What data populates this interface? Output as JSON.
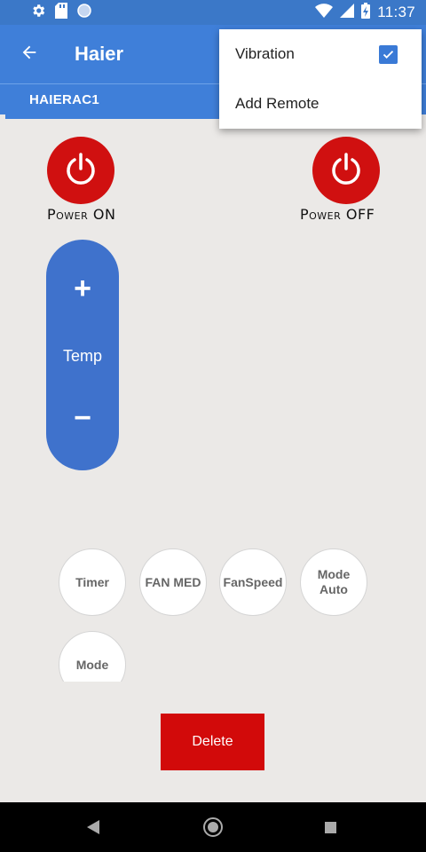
{
  "status_bar": {
    "time": "11:37",
    "icons": [
      "gear-icon",
      "sd-card-icon",
      "circle-icon",
      "wifi-icon",
      "signal-icon",
      "battery-charging-icon"
    ]
  },
  "app_bar": {
    "title": "Haier",
    "back_icon": "arrow-left-icon"
  },
  "tab": {
    "label": "HAIERAC1"
  },
  "overflow_menu": {
    "items": [
      {
        "label": "Vibration",
        "checked": true
      },
      {
        "label": "Add Remote"
      }
    ]
  },
  "remote": {
    "power_on_label": "Power ON",
    "power_off_label": "Power OFF",
    "power_icon": "power-icon",
    "temp": {
      "plus": "+",
      "label": "Temp",
      "minus": "−"
    },
    "buttons": [
      {
        "label": "Timer"
      },
      {
        "label": "FAN MED"
      },
      {
        "label": "FanSpeed"
      },
      {
        "label": "Mode\nAuto"
      },
      {
        "label": "Mode"
      }
    ],
    "delete_label": "Delete"
  },
  "colors": {
    "primary": "#3f7fd9",
    "power_red": "#d01010",
    "delete_red": "#d20a0a",
    "temp_blue": "#3f72cc",
    "background": "#ebe9e7"
  },
  "nav_bar": {
    "icons": [
      "nav-back-icon",
      "nav-home-icon",
      "nav-recents-icon"
    ]
  }
}
